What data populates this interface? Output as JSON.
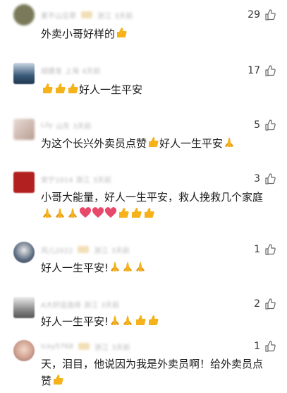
{
  "comments": [
    {
      "user": "麦不山见草",
      "location": "浙江",
      "time": "3天前",
      "likes": "29",
      "text": "外卖小哥好样的",
      "emojis": [
        "thumbs-up"
      ],
      "avatar_color": "#7a7a5a",
      "avatar_style": "round"
    },
    {
      "user": "胡建发",
      "location": "上海",
      "time": "4天前",
      "likes": "17",
      "text": "好人一生平安",
      "emojis_before": [
        "thumbs-up",
        "thumbs-up",
        "thumbs-up"
      ],
      "avatar_color": "#3a5a7a",
      "avatar_style": "square"
    },
    {
      "user": "Lily",
      "location": "山东",
      "time": "3天前",
      "likes": "5",
      "text_parts": [
        "为这个长兴外卖员点赞",
        "好人一生平安"
      ],
      "emojis_mid": [
        "thumbs-up"
      ],
      "emojis_end": [
        "prayer"
      ],
      "avatar_color": "#c7b8b0",
      "avatar_style": "square"
    },
    {
      "user": "安宁1014",
      "location": "浙江",
      "time": "3天前",
      "likes": "3",
      "line1": "小哥大能量，好人一生平安，救人挽救几个家庭",
      "emojis_line2": [
        "prayer",
        "prayer",
        "prayer",
        "heart",
        "heart",
        "heart",
        "thumbs-up",
        "thumbs-up",
        "thumbs-up"
      ],
      "avatar_color": "#b32020",
      "avatar_style": "square"
    },
    {
      "user": "风儿2022",
      "location": "浙江",
      "time": "3天前",
      "likes": "1",
      "text": "好人一生平安!",
      "emojis": [
        "prayer",
        "prayer",
        "prayer"
      ],
      "avatar_color": "#5a6a80",
      "avatar_style": "round"
    },
    {
      "user": "A大好运连续",
      "location": "浙江",
      "time": "3天前",
      "likes": "2",
      "text": "好人一生平安!",
      "emojis": [
        "prayer",
        "prayer",
        "thumbs-up",
        "thumbs-up"
      ],
      "avatar_color": "#8a8a8a",
      "avatar_style": "square"
    },
    {
      "user": "Icey5768",
      "location": "浙江",
      "time": "3天前",
      "likes": "1",
      "line1": "天，泪目，他说因为我是外卖员啊！给外卖员点",
      "line2": "赞",
      "emojis_line2": [
        "thumbs-up"
      ],
      "avatar_color": "#d0a090",
      "avatar_style": "round"
    }
  ],
  "icons": {
    "like": "thumbs-up-outline-icon"
  },
  "colors": {
    "meta_text": "#b9b9b9",
    "body_text": "#1a1a1a",
    "thumb_emoji": "#f6b21b",
    "heart_emoji": "#e8486a"
  }
}
